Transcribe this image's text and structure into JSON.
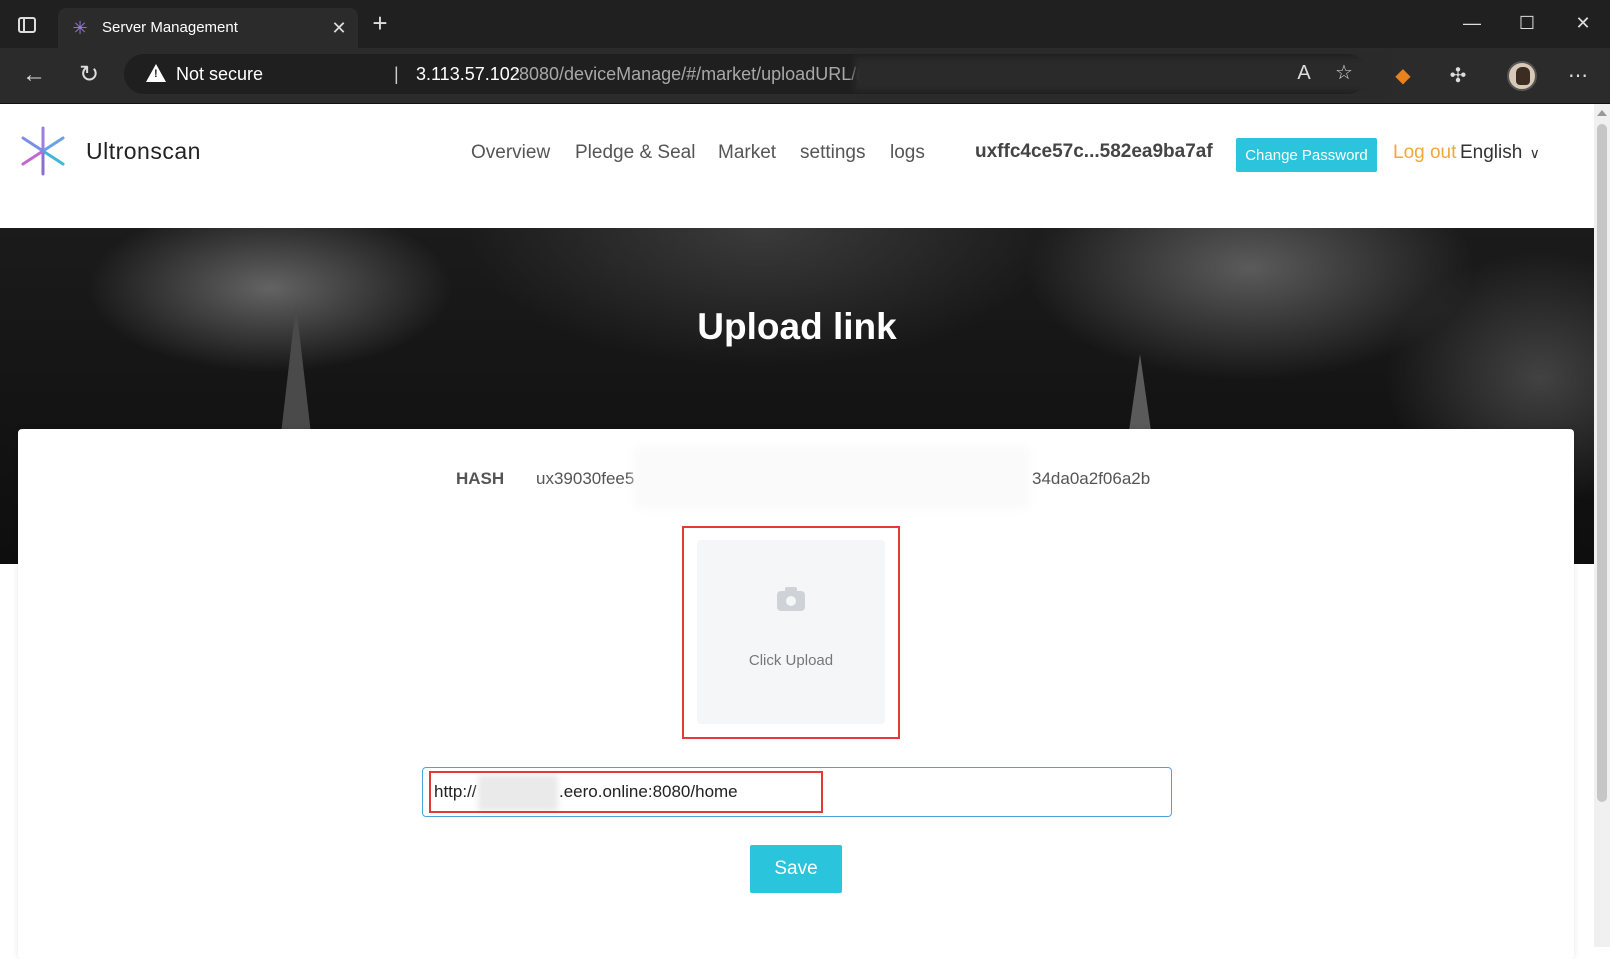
{
  "browser": {
    "tab_title": "Server Management",
    "tab_icon": "ultronscan-favicon-icon",
    "not_secure": "Not secure",
    "url_host": "3.113.57.102",
    "url_rest": ":8080/deviceManage/#/market/uploadURL/(",
    "toolbar_icons": [
      "read-aloud-icon",
      "favorites-add-icon",
      "metamask-fox-icon",
      "extensions-icon",
      "profile-avatar",
      "more-menu-icon"
    ]
  },
  "header": {
    "logo_text": "Ultronscan",
    "nav": [
      "Overview",
      "Pledge & Seal",
      "Market",
      "settings",
      "logs"
    ],
    "account": "uxffc4ce57c...582ea9ba7af",
    "change_password": "Change Password",
    "logout": "Log out",
    "language": "English"
  },
  "hero": {
    "title": "Upload link"
  },
  "form": {
    "hash_label": "HASH",
    "hash_start": "ux39030fee5",
    "hash_end": "34da0a2f06a2b",
    "upload_label": "Click Upload",
    "url_prefix": "http://",
    "url_suffix": ".eero.online:8080/home",
    "save_label": "Save"
  },
  "colors": {
    "accent": "#2ac4dd",
    "logout": "#f0a83a",
    "highlight": "#e53935"
  }
}
